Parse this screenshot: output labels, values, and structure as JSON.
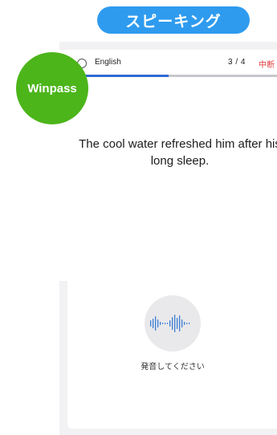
{
  "banner": {
    "title": "スピーキング"
  },
  "brand": {
    "name": "Winpass"
  },
  "header": {
    "language_label": "English",
    "progress_text": "3 / 4",
    "quit_label": "中断"
  },
  "progress": {
    "current": 3,
    "total": 4,
    "fraction": 0.5
  },
  "question": {
    "sentence": "The cool water refreshed him after his long sleep."
  },
  "speaking": {
    "prompt": "発音してください",
    "icon": "waveform-icon"
  },
  "colors": {
    "banner": "#2e9bef",
    "brand_badge": "#4cb51a",
    "progress_fill": "#2f6bd3",
    "quit": "#e33b3b"
  }
}
